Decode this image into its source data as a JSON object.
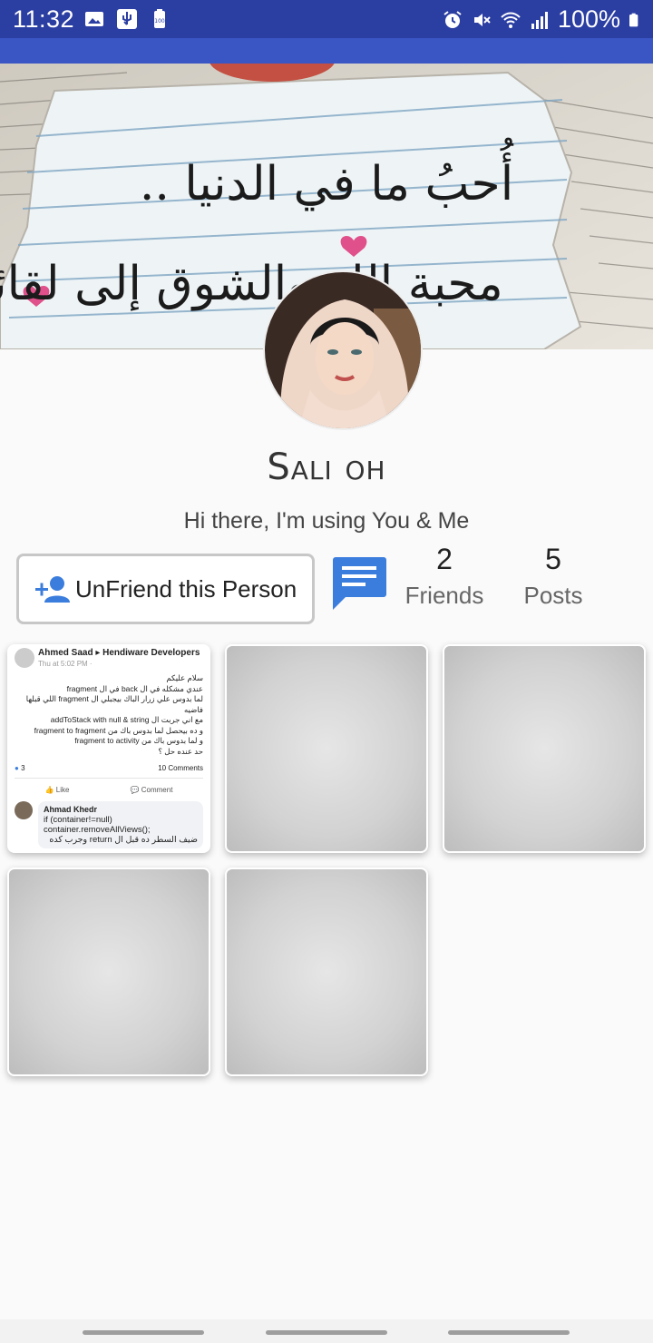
{
  "status_bar": {
    "time": "11:32",
    "battery_pct": "100%",
    "left_icons": [
      "image-icon",
      "usb-icon",
      "battery-saver-icon"
    ],
    "right_icons": [
      "alarm-icon",
      "mute-icon",
      "wifi-icon",
      "signal-icon",
      "battery-icon"
    ]
  },
  "profile": {
    "name": "Sali oh",
    "status": "Hi there, I'm using You & Me",
    "cover_text": "أُحبُ ما في الدنيا .. محبة الله والشوق إلى لقائه"
  },
  "actions": {
    "unfriend_label": "UnFriend this Person",
    "unfriend_icon": "person-add-icon",
    "chat_icon": "chat-icon"
  },
  "stats": {
    "friends_count": "2",
    "friends_label": "Friends",
    "posts_count": "5",
    "posts_label": "Posts"
  },
  "post_preview": {
    "author": "Ahmed Saad ▸ Hendiware Developers",
    "time": "Thu at 5:02 PM ·",
    "body_lines": [
      "سلام عليكم",
      "عندي مشكله في ال back في ال fragment",
      "لما بدوس علي زرار الباك بيجبلي ال fragment اللي قبلها فاضيه",
      "مع اني جربت ال addToStack with null & string",
      "و ده بيحصل لما بدوس باك من fragment to fragment",
      "و لما بدوس باك من fragment to activity",
      "حد عنده حل ؟"
    ],
    "reactions": "3",
    "comments_count": "10 Comments",
    "like_label": "Like",
    "comment_label": "Comment",
    "commenter": "Ahmad Khedr",
    "comment_lines": [
      "if (container!=null)",
      "container.removeAllViews();",
      "ضيف السطر ده قبل ال return وجرب كده"
    ]
  },
  "colors": {
    "status_bar": "#2b3ea2",
    "app_bar": "#3a55c4",
    "accent": "#3b7ddd"
  }
}
